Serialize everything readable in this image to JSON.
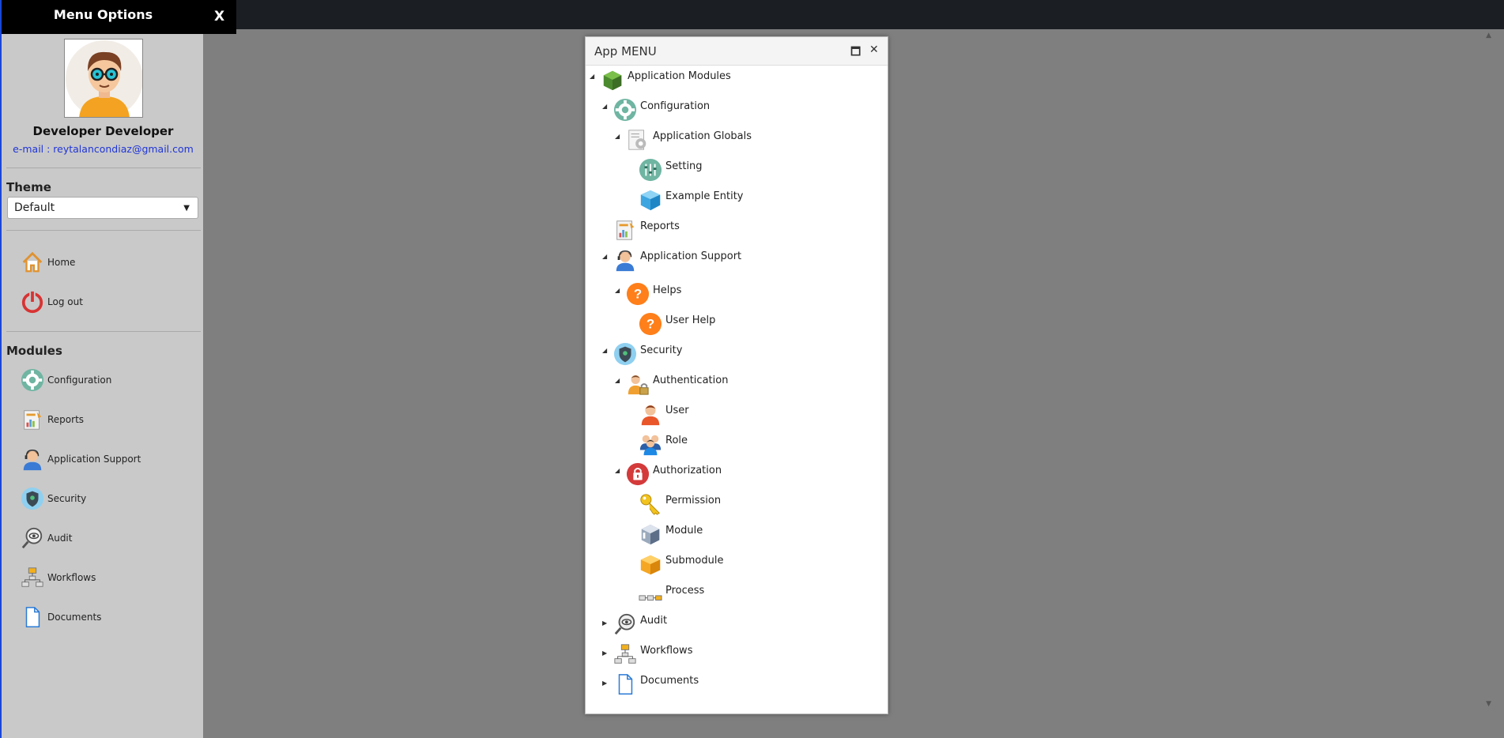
{
  "side_panel": {
    "title": "Menu Options",
    "close": "X",
    "user_name": "Developer Developer",
    "email": "e-mail : reytalancondiaz@gmail.com",
    "theme_label": "Theme",
    "theme_value": "Default",
    "nav": [
      {
        "label": "Home",
        "icon": "home-icon"
      },
      {
        "label": "Log out",
        "icon": "power-icon"
      }
    ],
    "modules_label": "Modules",
    "modules": [
      {
        "label": "Configuration",
        "icon": "gear-icon"
      },
      {
        "label": "Reports",
        "icon": "report-icon"
      },
      {
        "label": "Application Support",
        "icon": "support-agent-icon"
      },
      {
        "label": "Security",
        "icon": "shield-icon"
      },
      {
        "label": "Audit",
        "icon": "magnifier-eye-icon"
      },
      {
        "label": "Workflows",
        "icon": "workflow-icon"
      },
      {
        "label": "Documents",
        "icon": "document-icon"
      }
    ]
  },
  "window": {
    "title": "App MENU",
    "maximize": "🗖",
    "close": "✕",
    "tree": [
      {
        "label": "Application Modules",
        "icon": "cube-green-icon",
        "toggle": "◢"
      },
      {
        "label": "Configuration",
        "icon": "gear-icon",
        "toggle": "◢"
      },
      {
        "label": "Application Globals",
        "icon": "settings-doc-icon",
        "toggle": "◢"
      },
      {
        "label": "Setting",
        "icon": "sliders-icon",
        "toggle": ""
      },
      {
        "label": "Example Entity",
        "icon": "cube-blue-icon",
        "toggle": ""
      },
      {
        "label": "Reports",
        "icon": "report-icon",
        "toggle": ""
      },
      {
        "label": "Application Support",
        "icon": "support-agent-icon",
        "toggle": "◢"
      },
      {
        "label": "Helps",
        "icon": "help-icon",
        "toggle": "◢"
      },
      {
        "label": "User Help",
        "icon": "help-icon",
        "toggle": ""
      },
      {
        "label": "Security",
        "icon": "shield-icon",
        "toggle": "◢"
      },
      {
        "label": "Authentication",
        "icon": "user-lock-icon",
        "toggle": "◢"
      },
      {
        "label": "User",
        "icon": "user-icon",
        "toggle": ""
      },
      {
        "label": "Role",
        "icon": "group-icon",
        "toggle": ""
      },
      {
        "label": "Authorization",
        "icon": "lock-icon",
        "toggle": "◢"
      },
      {
        "label": "Permission",
        "icon": "key-icon",
        "toggle": ""
      },
      {
        "label": "Module",
        "icon": "box-icon",
        "toggle": ""
      },
      {
        "label": "Submodule",
        "icon": "cube-orange-icon",
        "toggle": ""
      },
      {
        "label": "Process",
        "icon": "process-icon",
        "toggle": ""
      },
      {
        "label": "Audit",
        "icon": "magnifier-eye-icon",
        "toggle": "▶"
      },
      {
        "label": "Workflows",
        "icon": "workflow-icon",
        "toggle": "▶"
      },
      {
        "label": "Documents",
        "icon": "document-icon",
        "toggle": "▶"
      }
    ]
  }
}
